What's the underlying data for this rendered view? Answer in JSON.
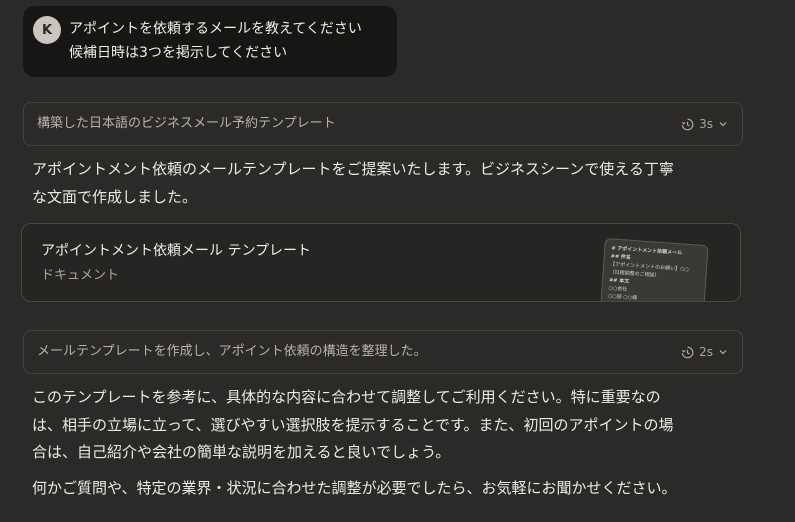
{
  "user_message": {
    "avatar_initial": "K",
    "line1": "アポイントを依頼するメールを教えてください",
    "line2": "候補日時は3つを掲示してください"
  },
  "thought1": {
    "title": "構築した日本語のビジネスメール予約テンプレート",
    "duration": "3s"
  },
  "intro": {
    "line1": "アポイントメント依頼のメールテンプレートをご提案いたします。ビジネスシーンで使える丁寧",
    "line2": "な文面で作成しました。"
  },
  "artifact": {
    "title": "アポイントメント依頼メール テンプレート",
    "type": "ドキュメント",
    "preview_lines": [
      "# アポイントメント依頼メール",
      "## 件名",
      "【アポイントメントのお願い】○○",
      "（日程調整のご相談）",
      "## 本文",
      "○○会社",
      "○○部 ○○様"
    ]
  },
  "thought2": {
    "title": "メールテンプレートを作成し、アポイント依頼の構造を整理した。",
    "duration": "2s"
  },
  "closing": {
    "p1_line1": "このテンプレートを参考に、具体的な内容に合わせて調整してご利用ください。特に重要なの",
    "p1_line2": "は、相手の立場に立って、選びやすい選択肢を提示することです。また、初回のアポイントの場",
    "p1_line3": "合は、自己紹介や会社の簡単な説明を加えると良いでしょう。",
    "p2": "何かご質問や、特定の業界・状況に合わせた調整が必要でしたら、お気軽にお聞かせください。"
  }
}
